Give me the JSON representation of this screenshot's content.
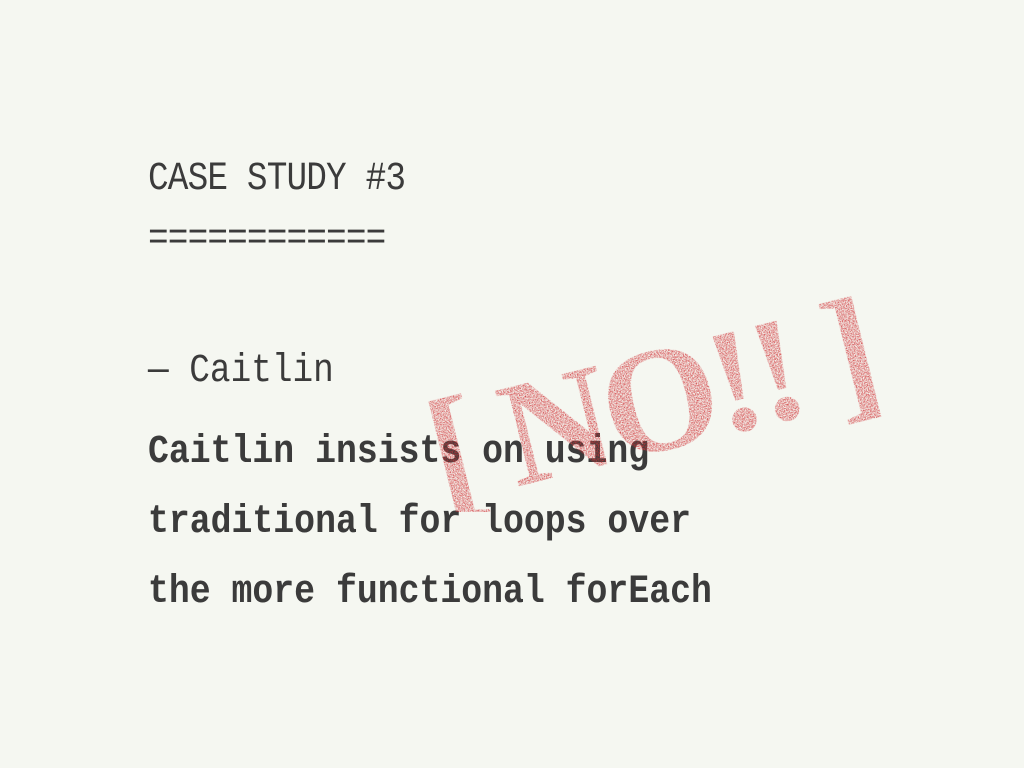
{
  "slide": {
    "heading": "CASE STUDY #3",
    "underline": "============",
    "author": "— Caitlin",
    "body_lines": [
      "Caitlin insists on using",
      "traditional for loops over",
      "the more functional forEach"
    ],
    "stamp": {
      "text": "[ NO!! ]",
      "color": "#d0373b"
    },
    "background_color": "#f5f7f1",
    "text_color": "#3b3b3b"
  }
}
